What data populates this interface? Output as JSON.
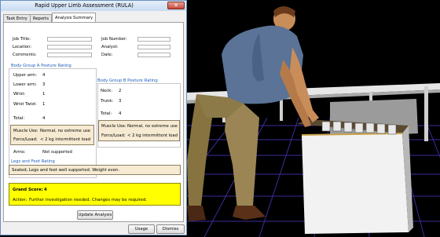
{
  "window": {
    "title": "Rapid Upper Limb Assessment (RULA)",
    "close_glyph": "✕"
  },
  "tabs": [
    {
      "label": "Task Entry"
    },
    {
      "label": "Reports"
    },
    {
      "label": "Analysis Summary"
    }
  ],
  "job_info": {
    "job_title_label": "Job Title:",
    "location_label": "Location:",
    "comments_label": "Comments:",
    "job_number_label": "Job Number:",
    "analyst_label": "Analyst:",
    "date_label": "Date:",
    "job_title": "",
    "location": "",
    "comments": "",
    "job_number": "",
    "analyst": "",
    "date": ""
  },
  "group_a": {
    "title": "Body Group A Posture Rating",
    "rows": [
      {
        "label": "Upper arm:",
        "value": "4"
      },
      {
        "label": "Lower arm:",
        "value": "3"
      },
      {
        "label": "Wrist:",
        "value": "1"
      },
      {
        "label": "Wrist Twist:",
        "value": "1"
      }
    ],
    "total_label": "Total:",
    "total": "4",
    "muscle_use_label": "Muscle Use:",
    "muscle_use": "Normal, no extreme use",
    "force_label": "Force/Load:",
    "force": "< 2 kg intermittent load",
    "arms_label": "Arms:",
    "arms": "Not supported"
  },
  "group_b": {
    "title": "Body Group B Posture Rating",
    "rows": [
      {
        "label": "Neck:",
        "value": "2"
      },
      {
        "label": "Trunk:",
        "value": "3"
      }
    ],
    "total_label": "Total:",
    "total": "4",
    "muscle_use_label": "Muscle Use:",
    "muscle_use": "Normal, no extreme use",
    "force_label": "Force/Load:",
    "force": "< 2 kg intermittent load"
  },
  "legs": {
    "title": "Legs and Feet Rating",
    "text": "Seated, Legs and feet well supported.  Weight even."
  },
  "grand": {
    "label": "Grand Score:",
    "score": "4",
    "action_label": "Action:",
    "action": "Further investigation needed.  Changes may be required."
  },
  "buttons": {
    "update": "Update Analysis",
    "usage": "Usage",
    "dismiss": "Dismiss"
  },
  "colors": {
    "section_title": "#1e5bb8",
    "highlight_tan": "#f6ead2",
    "grand_score_bg": "#ffff00",
    "scene_floor_grid": "#3c2c9c"
  }
}
